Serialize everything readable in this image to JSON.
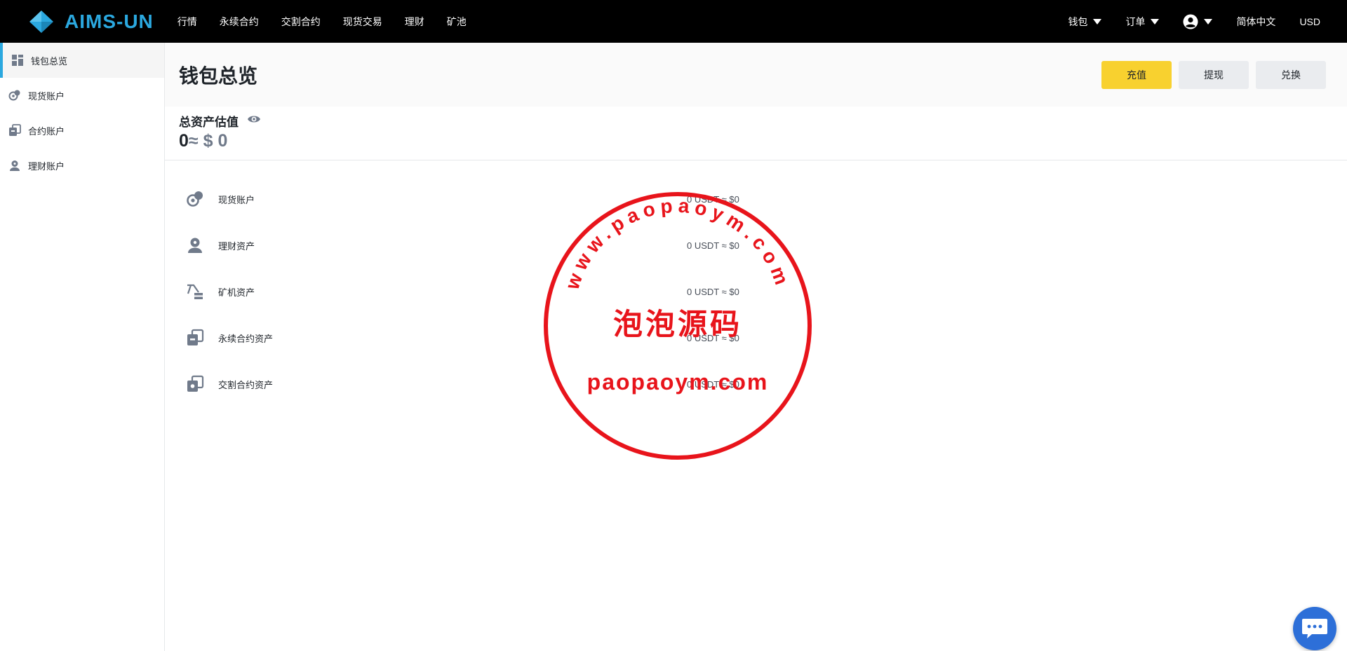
{
  "brand": {
    "name": "AIMS-UN",
    "logo_color": "#2ba8df"
  },
  "nav": {
    "items": [
      "行情",
      "永续合约",
      "交割合约",
      "现货交易",
      "理财",
      "矿池"
    ]
  },
  "right_nav": {
    "wallet": "钱包",
    "orders": "订单",
    "language": "简体中文",
    "currency": "USD"
  },
  "sidebar": {
    "items": [
      {
        "label": "钱包总览",
        "icon": "dashboard-icon",
        "active": true
      },
      {
        "label": "现货账户",
        "icon": "spot-icon"
      },
      {
        "label": "合约账户",
        "icon": "contract-icon"
      },
      {
        "label": "理财账户",
        "icon": "finance-icon"
      }
    ]
  },
  "page": {
    "title": "钱包总览",
    "actions": {
      "deposit": "充值",
      "withdraw": "提现",
      "convert": "兑换"
    }
  },
  "summary": {
    "label": "总资产估值",
    "value": "0",
    "approx": "≈",
    "fiat": "$ 0"
  },
  "assets": [
    {
      "name": "现货账户",
      "value": "0 USDT ≈ $0",
      "icon": "spot-icon"
    },
    {
      "name": "理财资产",
      "value": "0 USDT ≈ $0",
      "icon": "finance-icon"
    },
    {
      "name": "矿机资产",
      "value": "0 USDT ≈ $0",
      "icon": "mining-icon"
    },
    {
      "name": "永续合约资产",
      "value": "0 USDT ≈ $0",
      "icon": "perpetual-icon"
    },
    {
      "name": "交割合约资产",
      "value": "0 USDT ≈ $0",
      "icon": "delivery-icon"
    }
  ],
  "watermark": {
    "arc_text": "www.paopaoym.com",
    "center_text": "泡泡源码",
    "bottom_text": "paopaoym.com",
    "color": "#e8141b"
  },
  "colors": {
    "accent": "#2ba8df",
    "primary_button": "#f8d12f",
    "secondary_button": "#eaecef",
    "chat": "#2d6fd8"
  }
}
